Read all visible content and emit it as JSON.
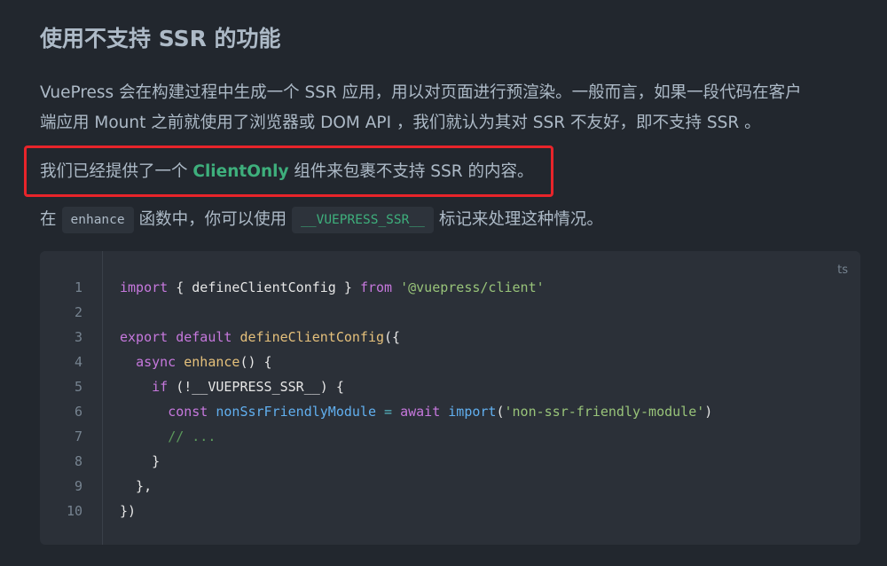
{
  "heading": "使用不支持 SSR 的功能",
  "paragraph1": {
    "line1": "VuePress 会在构建过程中生成一个 SSR 应用，用以对页面进行预渲染。一般而言，如果一段代码在客户",
    "line2": "端应用 Mount 之前就使用了浏览器或 DOM API ，我们就认为其对 SSR 不友好，即不支持 SSR 。"
  },
  "paragraph2": {
    "before": "我们已经提供了一个 ",
    "link": "ClientOnly",
    "after": " 组件来包裹不支持 SSR 的内容。"
  },
  "paragraph3": {
    "before": "在",
    "code1": "enhance",
    "middle": "函数中，你可以使用",
    "code2": "__VUEPRESS_SSR__",
    "after": "标记来处理这种情况。"
  },
  "code_block": {
    "language": "ts",
    "line_numbers": [
      "1",
      "2",
      "3",
      "4",
      "5",
      "6",
      "7",
      "8",
      "9",
      "10"
    ],
    "lines": [
      [
        [
          "purple",
          "import"
        ],
        [
          "ident",
          " { defineClientConfig } "
        ],
        [
          "purple",
          "from"
        ],
        [
          "ident",
          " "
        ],
        [
          "green2",
          "'@vuepress/client'"
        ]
      ],
      [],
      [
        [
          "purple",
          "export"
        ],
        [
          "ident",
          " "
        ],
        [
          "purple",
          "default"
        ],
        [
          "ident",
          " "
        ],
        [
          "yellow",
          "defineClientConfig"
        ],
        [
          "ident",
          "({"
        ]
      ],
      [
        [
          "ident",
          "  "
        ],
        [
          "purple",
          "async"
        ],
        [
          "ident",
          " "
        ],
        [
          "yellow",
          "enhance"
        ],
        [
          "ident",
          "() {"
        ]
      ],
      [
        [
          "ident",
          "    "
        ],
        [
          "purple",
          "if"
        ],
        [
          "ident",
          " (!__VUEPRESS_SSR__) {"
        ]
      ],
      [
        [
          "ident",
          "      "
        ],
        [
          "purple",
          "const"
        ],
        [
          "ident",
          " "
        ],
        [
          "blue",
          "nonSsrFriendlyModule"
        ],
        [
          "ident",
          " "
        ],
        [
          "cyan",
          "="
        ],
        [
          "ident",
          " "
        ],
        [
          "purple",
          "await"
        ],
        [
          "ident",
          " "
        ],
        [
          "blue",
          "import"
        ],
        [
          "ident",
          "("
        ],
        [
          "green2",
          "'non-ssr-friendly-module'"
        ],
        [
          "ident",
          ")"
        ]
      ],
      [
        [
          "ident",
          "      "
        ],
        [
          "comment",
          "// ..."
        ]
      ],
      [
        [
          "ident",
          "    }"
        ]
      ],
      [
        [
          "ident",
          "  },"
        ]
      ],
      [
        [
          "ident",
          "})"
        ]
      ]
    ]
  },
  "colors": {
    "background": "#22272e",
    "text": "#adbac7",
    "accent_green": "#3eaf7c",
    "highlight_border": "#e8242a",
    "code_background": "#2b3038"
  }
}
